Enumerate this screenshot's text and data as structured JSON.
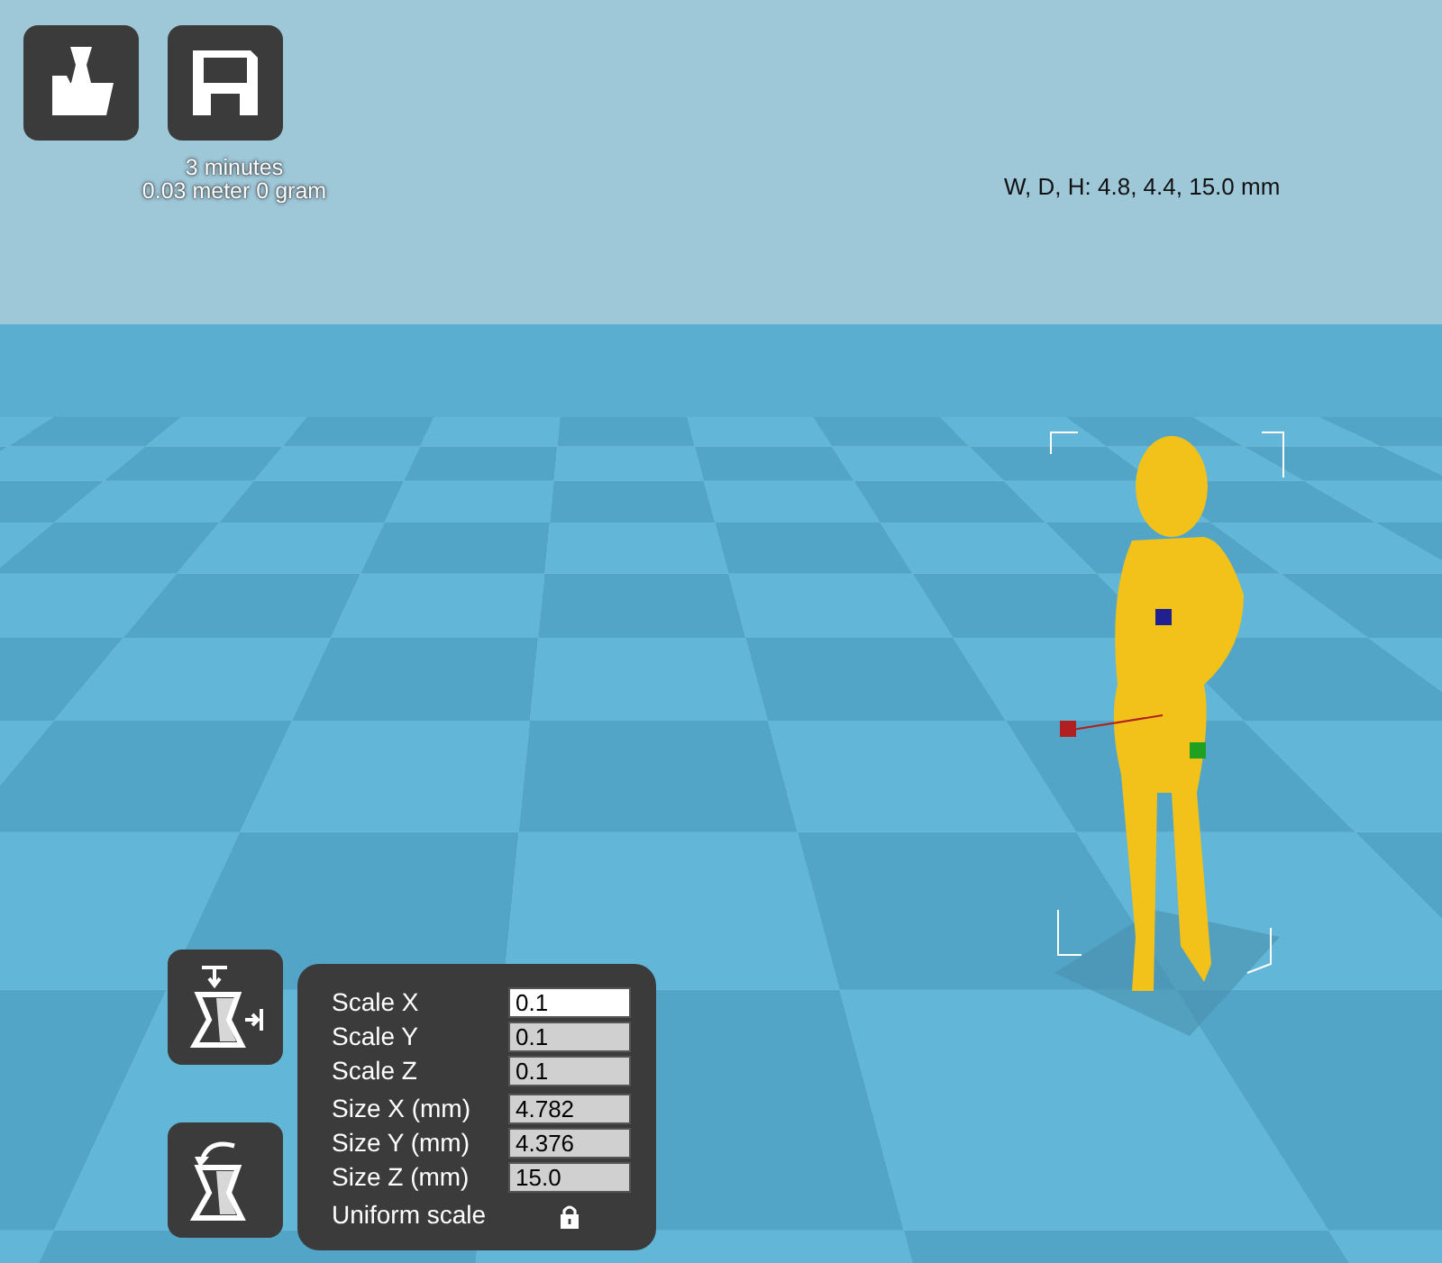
{
  "toolbar": {
    "buttons": [
      {
        "kind": "load"
      },
      {
        "kind": "save"
      }
    ]
  },
  "print_estimate": {
    "time": "3 minutes",
    "material": "0.03 meter 0 gram"
  },
  "dimensions": "W, D, H: 4.8, 4.4, 15.0 mm",
  "tools": [
    {
      "kind": "scale"
    },
    {
      "kind": "rotate"
    }
  ],
  "scale_panel": {
    "fields": [
      {
        "label": "Scale X",
        "value": "0.1",
        "focused": true
      },
      {
        "label": "Scale Y",
        "value": "0.1",
        "focused": false
      },
      {
        "label": "Scale Z",
        "value": "0.1",
        "focused": false
      },
      {
        "label": "Size X (mm)",
        "value": "4.782",
        "focused": false
      },
      {
        "label": "Size Y (mm)",
        "value": "4.376",
        "focused": false
      },
      {
        "label": "Size Z (mm)",
        "value": "15.0",
        "focused": false
      }
    ],
    "uniform_scale": {
      "label": "Uniform scale",
      "locked": true
    }
  }
}
